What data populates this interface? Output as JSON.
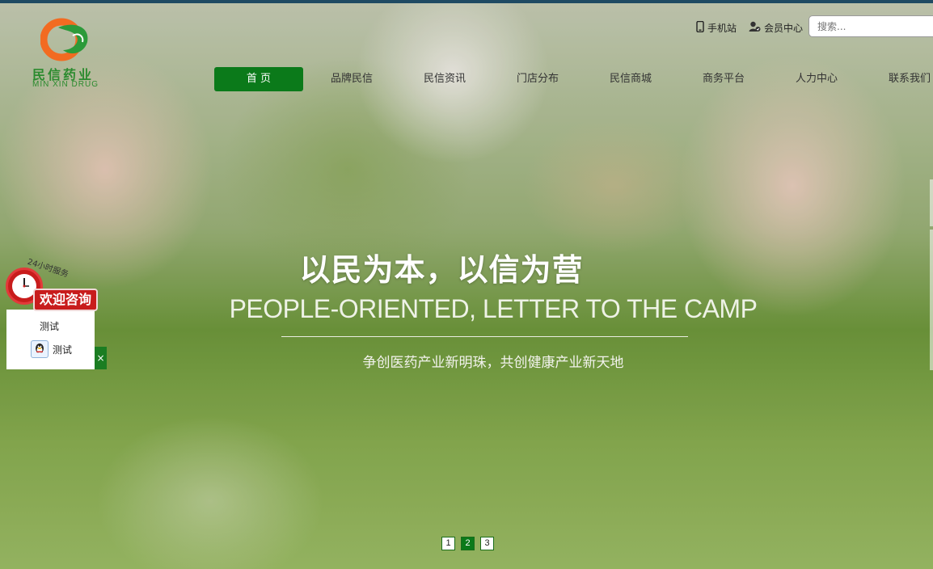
{
  "brand": {
    "name_cn": "民信药业",
    "name_en": "MIN  XIN DRUG",
    "accent_green": "#0b7a1a",
    "logo_orange": "#f26b21"
  },
  "header": {
    "mobile_label": "手机站",
    "member_label": "会员中心",
    "search_placeholder": "搜索..."
  },
  "nav": {
    "items": [
      "首 页",
      "品牌民信",
      "民信资讯",
      "门店分布",
      "民信商城",
      "商务平台",
      "人力中心",
      "联系我们"
    ],
    "active_index": 0
  },
  "hero": {
    "headline": "以民为本，以信为营",
    "subheadline": "PEOPLE-ORIENTED, LETTER TO THE CAMP",
    "tagline": "争创医药产业新明珠，共创健康产业新天地",
    "slides": [
      "1",
      "2",
      "3"
    ],
    "active_slide": 1
  },
  "customer_service": {
    "arc_label": "24小时服务",
    "banner": "欢迎咨询",
    "group_title": "测试",
    "qq_label": "测试",
    "close_glyph": "×"
  },
  "icons": {
    "mobile": "mobile-phone-icon",
    "member": "member-user-icon",
    "qq": "qq-penguin-icon",
    "clock": "clock-icon",
    "close": "close-icon"
  }
}
